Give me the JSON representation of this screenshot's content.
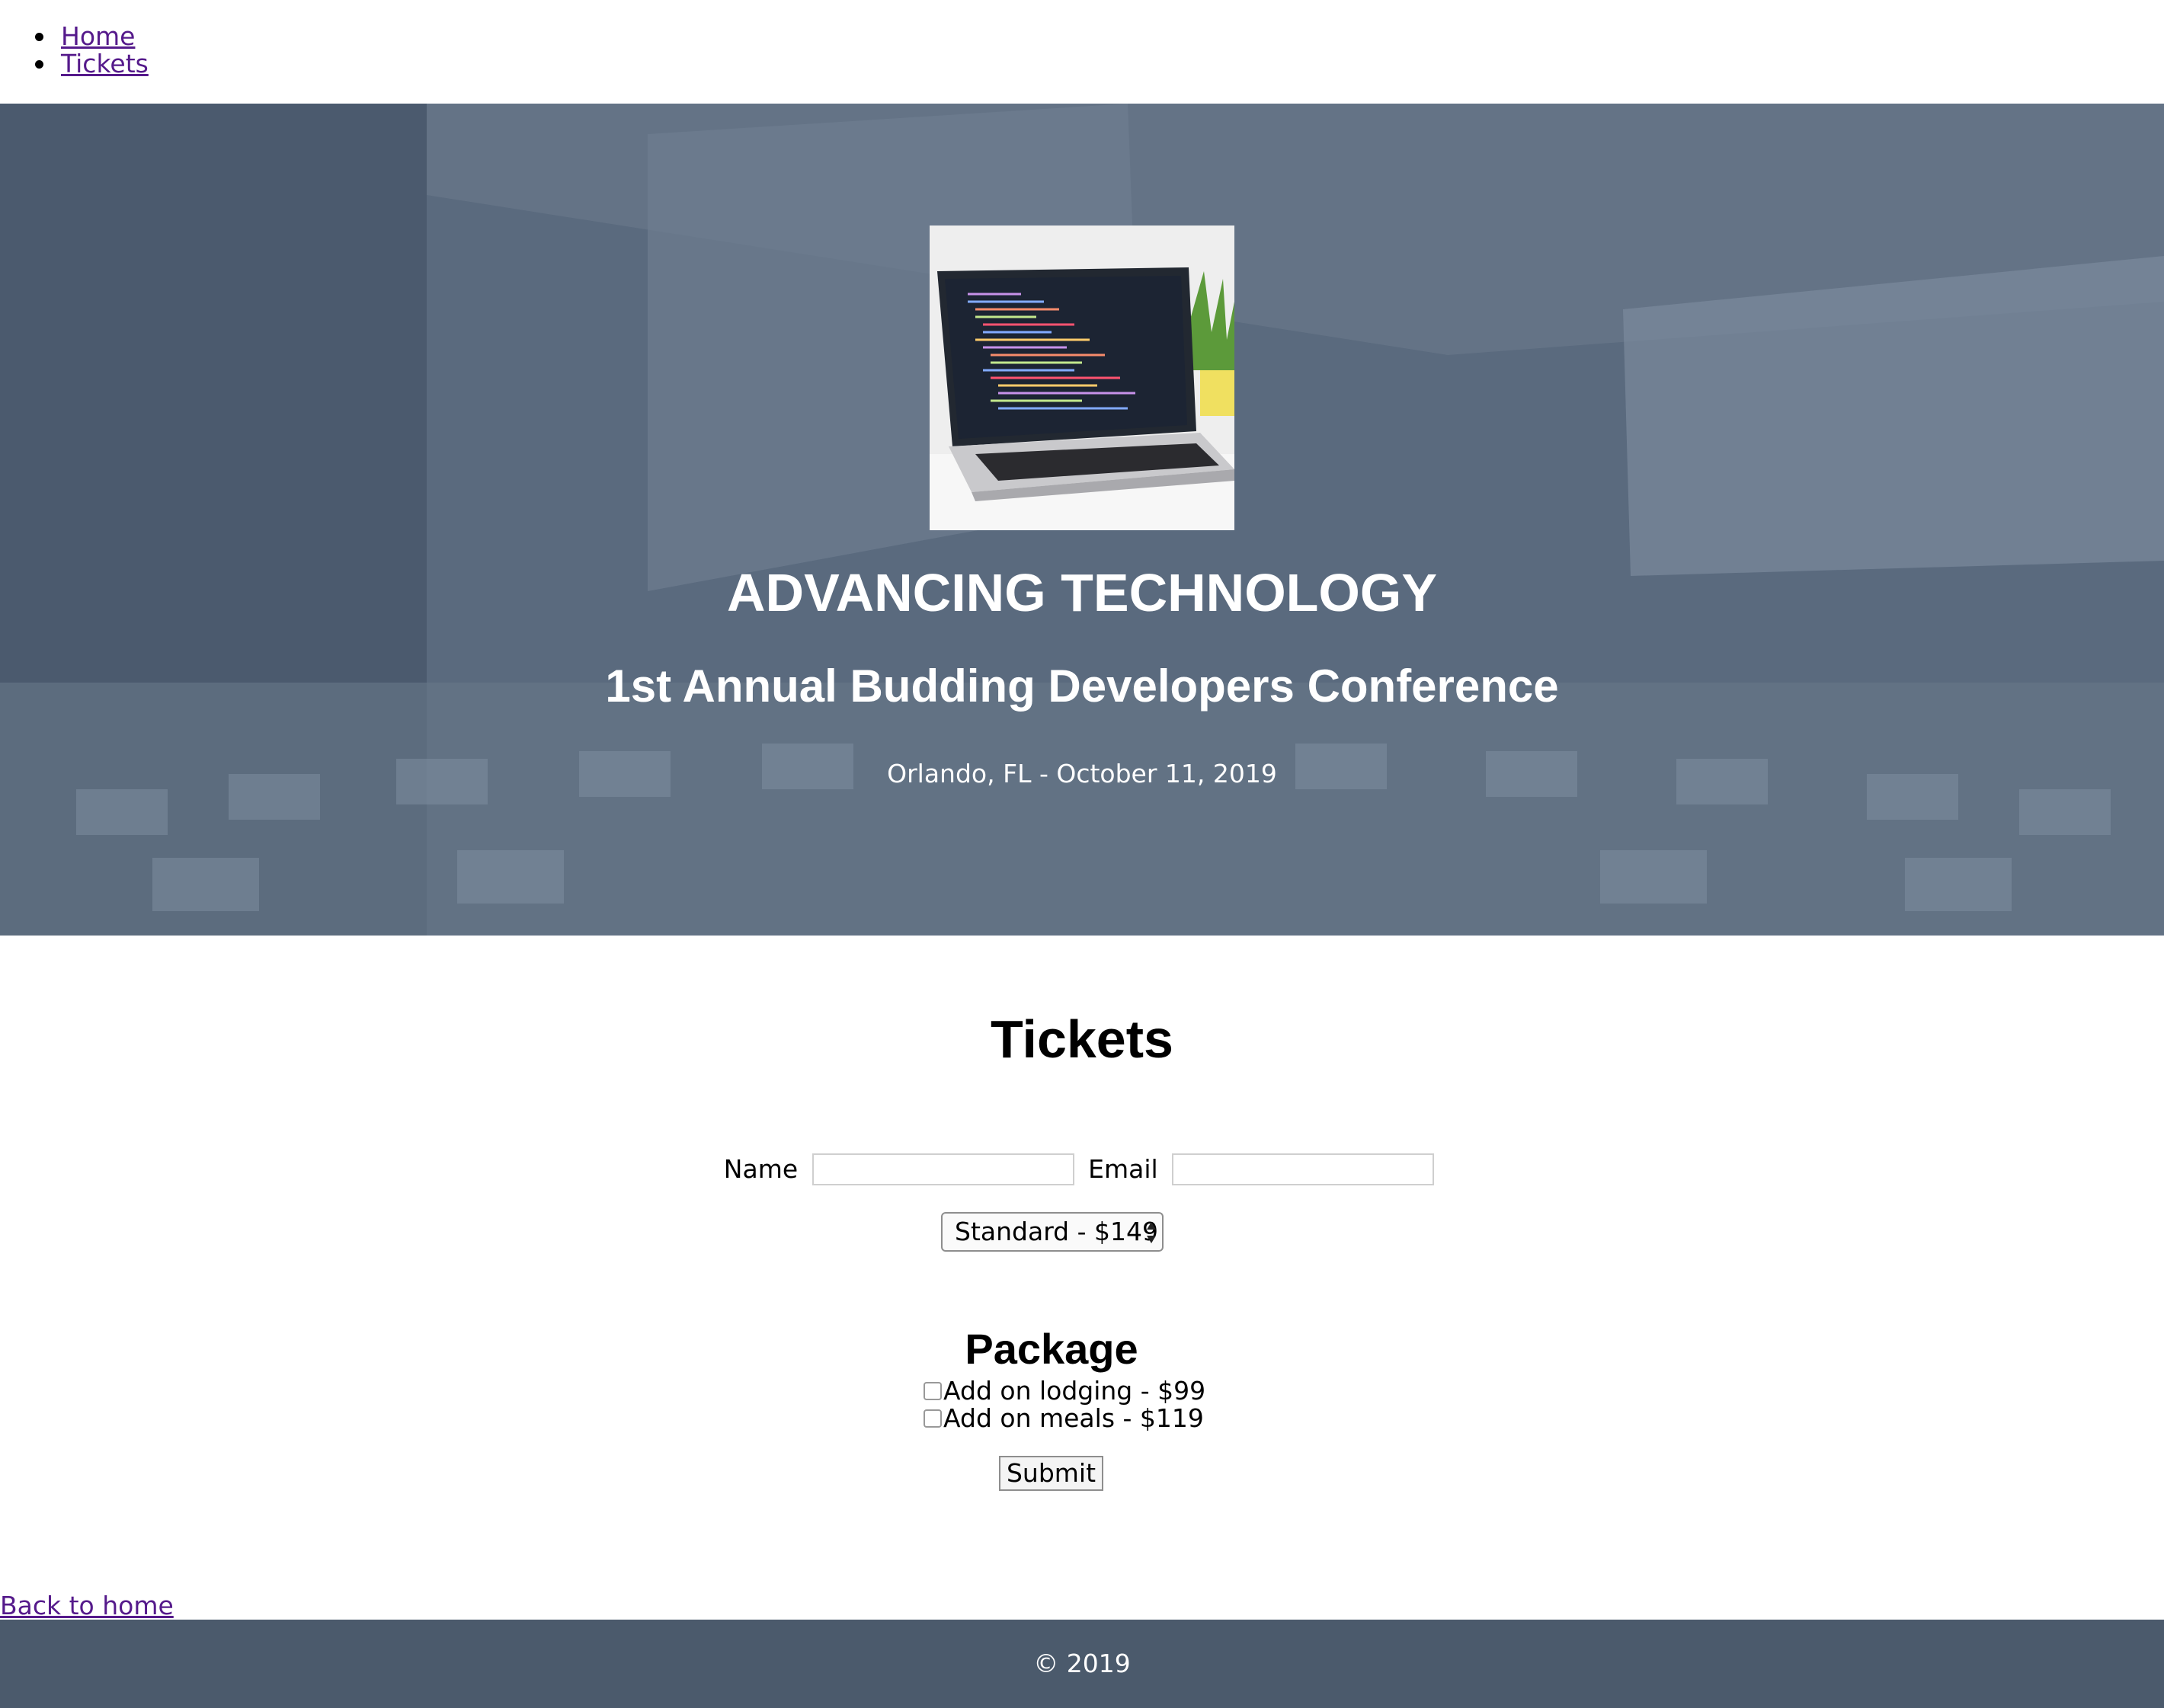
{
  "nav": {
    "items": [
      {
        "label": "Home"
      },
      {
        "label": "Tickets"
      }
    ]
  },
  "hero": {
    "title": "ADVANCING TECHNOLOGY",
    "subtitle": "1st Annual Budding Developers Conference",
    "meta": "Orlando, FL - October 11, 2019",
    "image_icon": "laptop-image"
  },
  "tickets": {
    "title": "Tickets",
    "form": {
      "name_label": "Name",
      "name_value": "",
      "email_label": "Email",
      "email_value": "",
      "ticket_select_value": "Standard - $149",
      "package_title": "Package",
      "addons": [
        {
          "label": "Add on lodging - $99",
          "checked": false
        },
        {
          "label": "Add on meals - $119",
          "checked": false
        }
      ],
      "submit_label": "Submit"
    }
  },
  "back_link": "Back to home",
  "footer": {
    "text": "© 2019"
  },
  "colors": {
    "hero_overlay": "#59687d",
    "footer_bg": "#4b5a6c",
    "visited_link": "#551a8b"
  }
}
